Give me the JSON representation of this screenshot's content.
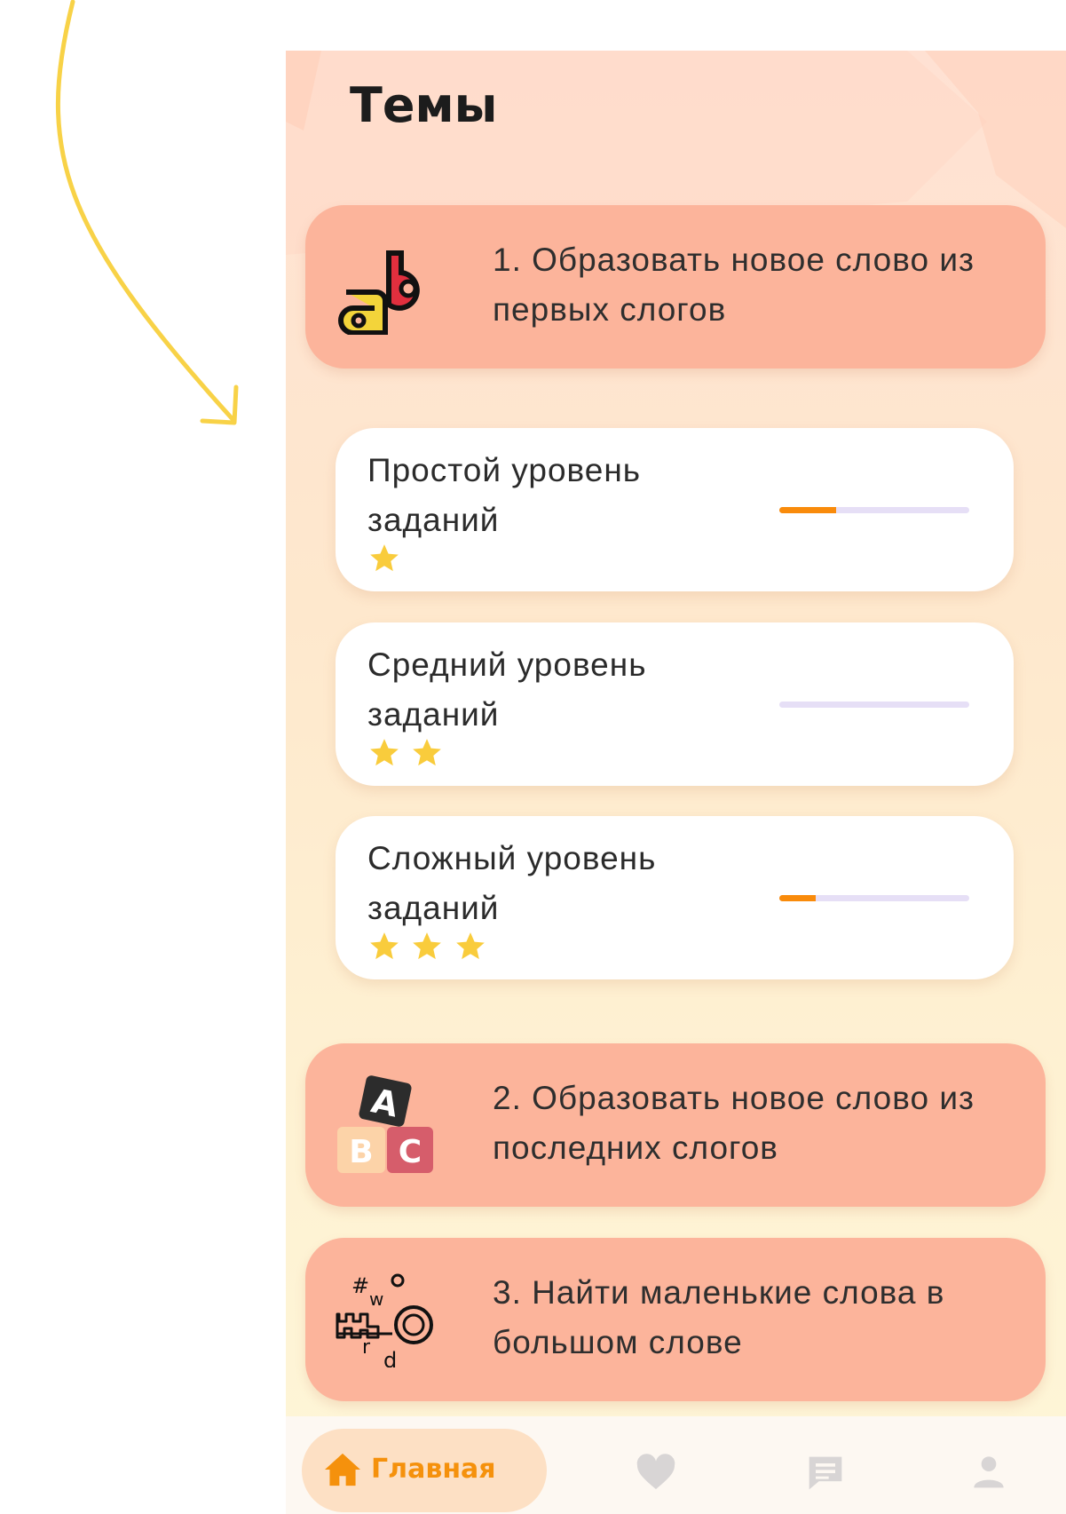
{
  "page": {
    "title": "Темы"
  },
  "topics": [
    {
      "label": "1. Образовать новое слово из первых слогов",
      "icon": "ab-letters-icon",
      "expanded": true
    },
    {
      "label": "2. Образовать новое слово из последних слогов",
      "icon": "abc-blocks-icon",
      "expanded": false
    },
    {
      "label": "3. Найти маленькие слова в большом слове",
      "icon": "key-word-icon",
      "expanded": false
    }
  ],
  "levels": [
    {
      "label": "Простой уровень заданий",
      "stars": 1,
      "progress": 0.3
    },
    {
      "label": "Средний уровень заданий",
      "stars": 2,
      "progress": 0.0
    },
    {
      "label": "Сложный уровень заданий",
      "stars": 3,
      "progress": 0.19
    }
  ],
  "nav": {
    "home_label": "Главная",
    "items": [
      "home-icon",
      "heart-icon",
      "chat-icon",
      "profile-icon"
    ],
    "active": "home"
  },
  "colors": {
    "topic_card": "#fcb49b",
    "accent": "#f5910c",
    "star": "#f9cc3c",
    "progress_track": "#e6dff6",
    "progress_fill": "#f98b0b",
    "annotation_arrow": "#f8d247"
  }
}
